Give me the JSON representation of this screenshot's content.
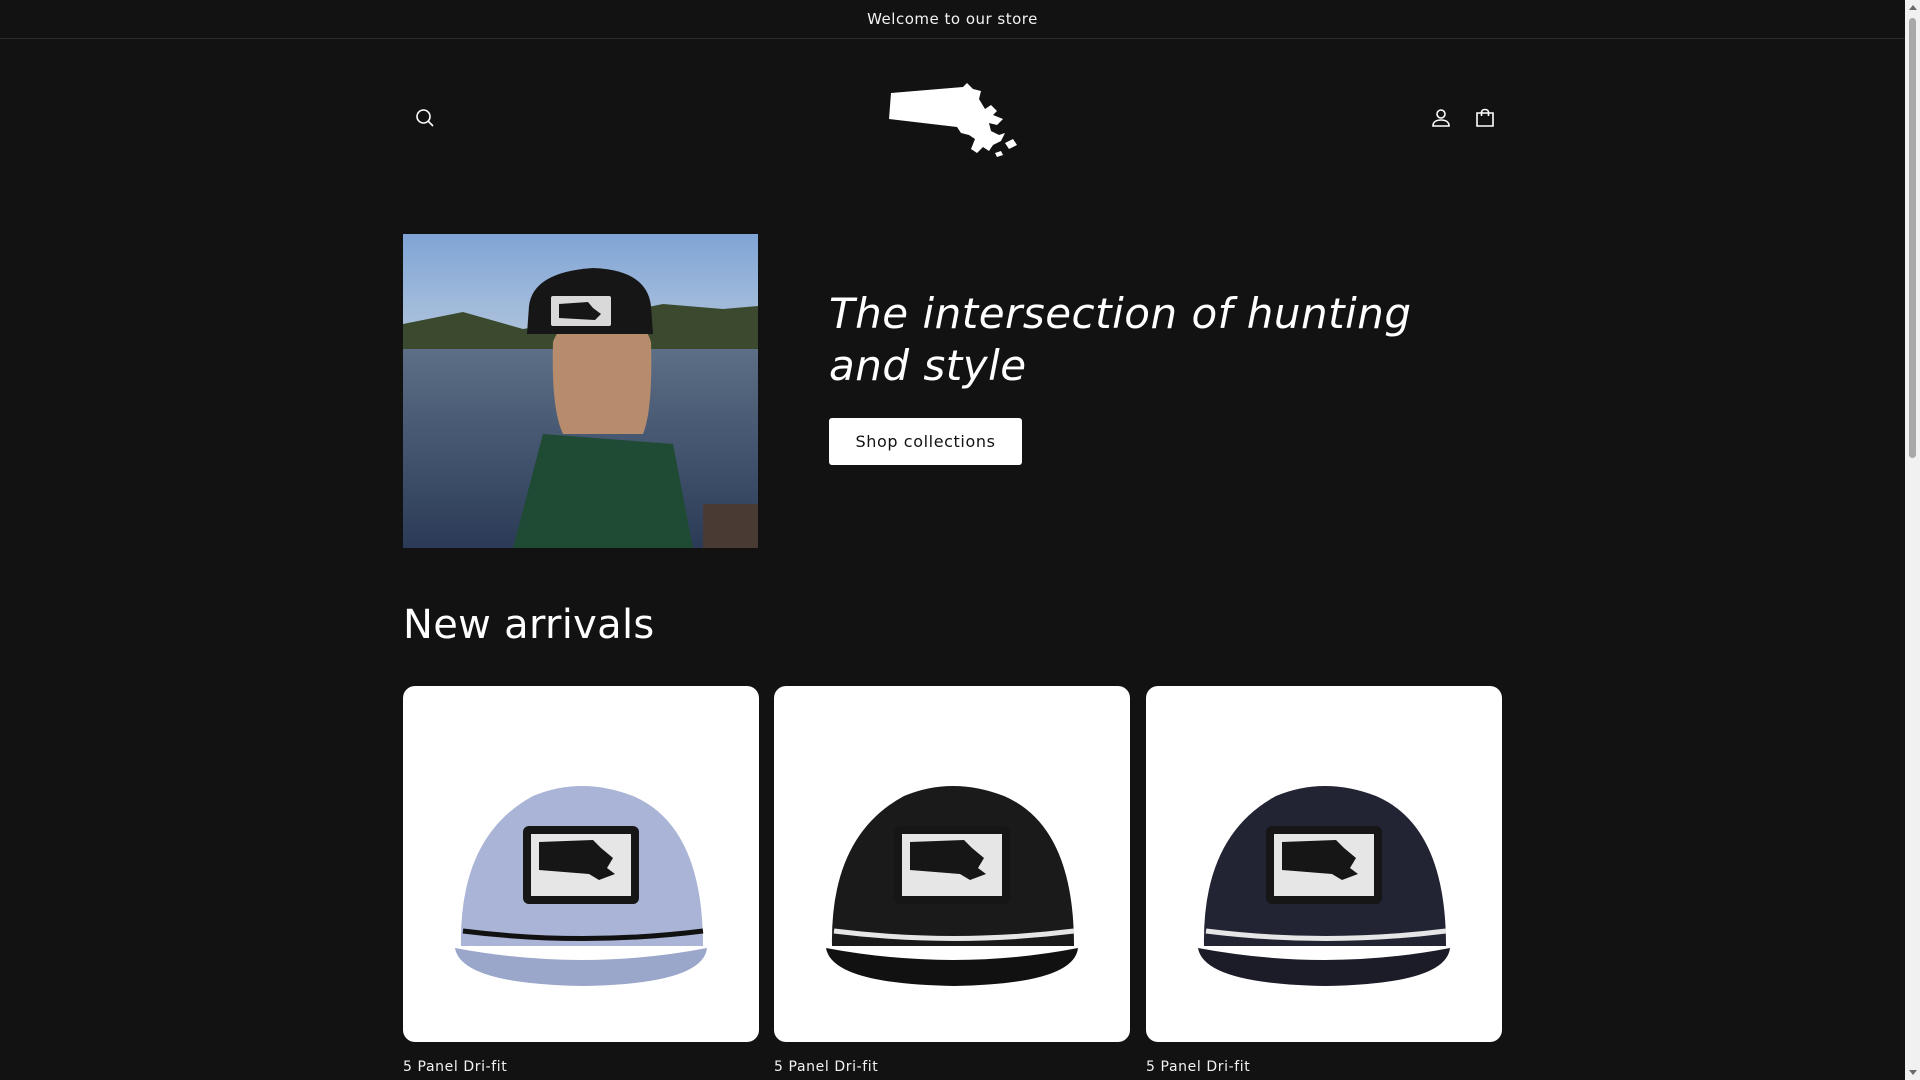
{
  "announcement": {
    "text": "Welcome to our store"
  },
  "header": {
    "search_icon": "search-icon",
    "logo": "massachusetts-state-logo",
    "account_icon": "account-icon",
    "cart_icon": "cart-icon"
  },
  "hero": {
    "title": "The intersection of hunting and style",
    "button_label": "Shop collections"
  },
  "new_arrivals": {
    "title": "New arrivals",
    "products": [
      {
        "name": "5 Panel Dri-fit",
        "color": "#a9b4d6"
      },
      {
        "name": "5 Panel Dri-fit",
        "color": "#1a1a1a"
      },
      {
        "name": "5 Panel Dri-fit",
        "color": "#232433"
      }
    ]
  },
  "colors": {
    "background": "#121212",
    "text": "#ffffff",
    "button_bg": "#ffffff",
    "button_text": "#121212"
  }
}
